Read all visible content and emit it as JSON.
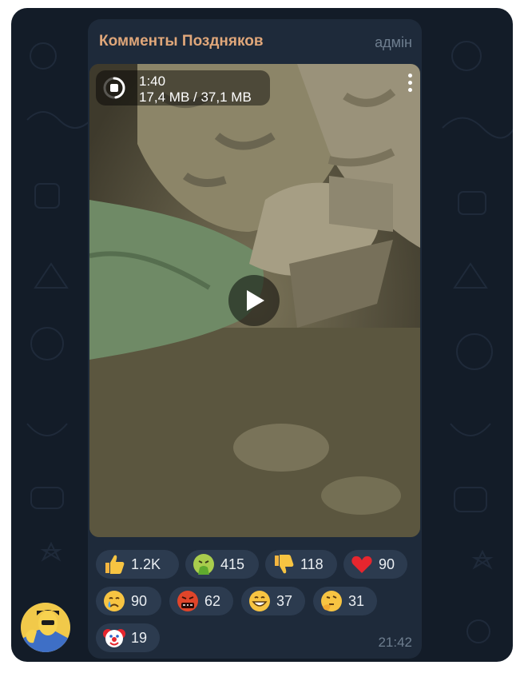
{
  "channel": {
    "name": "Комменты Поздняков",
    "role": "адмін"
  },
  "video": {
    "duration": "1:40",
    "file_size": "17,4 MB / 37,1 MB",
    "download_progress": 0.47,
    "icons": {
      "progress": "download-progress-icon",
      "menu": "more-vertical-icon",
      "play": "play-icon"
    }
  },
  "reactions": [
    {
      "emoji": "thumbs-up",
      "count": "1.2K"
    },
    {
      "emoji": "vomiting-face",
      "count": "415"
    },
    {
      "emoji": "thumbs-down",
      "count": "118"
    },
    {
      "emoji": "red-heart",
      "count": "90"
    },
    {
      "emoji": "crying-face",
      "count": "90"
    },
    {
      "emoji": "face-with-symbols-on-mouth",
      "count": "62"
    },
    {
      "emoji": "grinning-face",
      "count": "37"
    },
    {
      "emoji": "thinking-face",
      "count": "31"
    },
    {
      "emoji": "clown-face",
      "count": "19"
    }
  ],
  "message_time": "21:42",
  "colors": {
    "background": "#131c28",
    "bubble": "#1e2a3a",
    "sender_name": "#e0a77a",
    "reaction_pill": "#2c3b4f"
  }
}
